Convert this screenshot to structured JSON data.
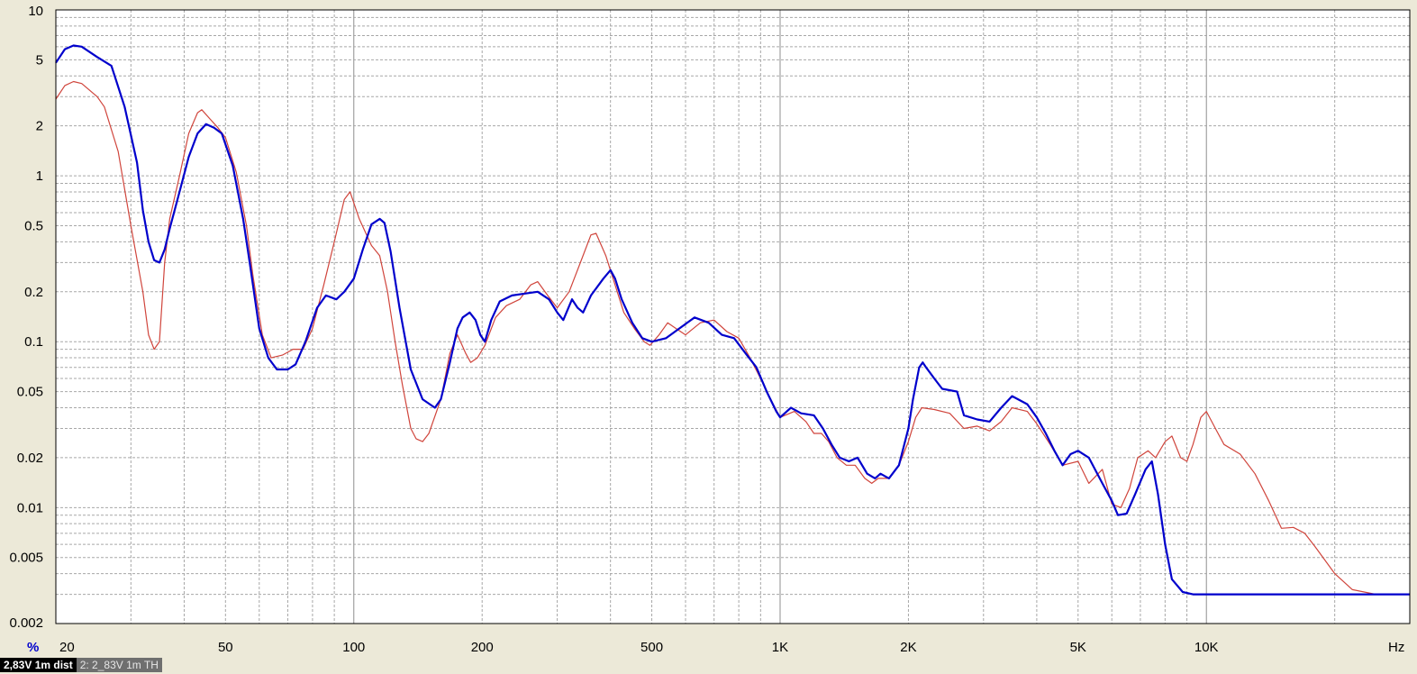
{
  "chart_data": {
    "type": "line",
    "xscale": "log",
    "yscale": "log",
    "xlim": [
      20,
      30000
    ],
    "ylim": [
      0.002,
      10
    ],
    "xlabel": "Hz",
    "ylabel": "%",
    "grid": true,
    "x_ticks": [
      {
        "value": 20,
        "label": "20"
      },
      {
        "value": 50,
        "label": "50"
      },
      {
        "value": 100,
        "label": "100"
      },
      {
        "value": 200,
        "label": "200"
      },
      {
        "value": 500,
        "label": "500"
      },
      {
        "value": 1000,
        "label": "1K"
      },
      {
        "value": 2000,
        "label": "2K"
      },
      {
        "value": 5000,
        "label": "5K"
      },
      {
        "value": 10000,
        "label": "10K"
      }
    ],
    "y_ticks": [
      {
        "value": 10,
        "label": "10"
      },
      {
        "value": 5,
        "label": "5"
      },
      {
        "value": 2,
        "label": "2"
      },
      {
        "value": 1,
        "label": "1"
      },
      {
        "value": 0.5,
        "label": "0.5"
      },
      {
        "value": 0.2,
        "label": "0.2"
      },
      {
        "value": 0.1,
        "label": "0.1"
      },
      {
        "value": 0.05,
        "label": "0.05"
      },
      {
        "value": 0.02,
        "label": "0.02"
      },
      {
        "value": 0.01,
        "label": "0.01"
      },
      {
        "value": 0.005,
        "label": "0.005"
      },
      {
        "value": 0.002,
        "label": "0.002"
      }
    ],
    "series": [
      {
        "name": "2,83V 1m dist",
        "color": "#0000cc",
        "points": [
          [
            20,
            4.8
          ],
          [
            21,
            5.8
          ],
          [
            22,
            6.1
          ],
          [
            23,
            6.0
          ],
          [
            25,
            5.2
          ],
          [
            27,
            4.6
          ],
          [
            29,
            2.6
          ],
          [
            31,
            1.2
          ],
          [
            32,
            0.62
          ],
          [
            33,
            0.4
          ],
          [
            34,
            0.31
          ],
          [
            35,
            0.3
          ],
          [
            36,
            0.36
          ],
          [
            37,
            0.48
          ],
          [
            39,
            0.8
          ],
          [
            41,
            1.3
          ],
          [
            43,
            1.8
          ],
          [
            45,
            2.05
          ],
          [
            47,
            1.95
          ],
          [
            49,
            1.8
          ],
          [
            52,
            1.15
          ],
          [
            55,
            0.55
          ],
          [
            57,
            0.3
          ],
          [
            60,
            0.12
          ],
          [
            63,
            0.08
          ],
          [
            66,
            0.068
          ],
          [
            70,
            0.068
          ],
          [
            73,
            0.073
          ],
          [
            77,
            0.1
          ],
          [
            82,
            0.16
          ],
          [
            86,
            0.19
          ],
          [
            91,
            0.18
          ],
          [
            95,
            0.2
          ],
          [
            100,
            0.24
          ],
          [
            105,
            0.36
          ],
          [
            110,
            0.51
          ],
          [
            115,
            0.55
          ],
          [
            118,
            0.52
          ],
          [
            122,
            0.35
          ],
          [
            128,
            0.16
          ],
          [
            136,
            0.068
          ],
          [
            145,
            0.045
          ],
          [
            155,
            0.04
          ],
          [
            160,
            0.045
          ],
          [
            168,
            0.075
          ],
          [
            175,
            0.12
          ],
          [
            180,
            0.14
          ],
          [
            187,
            0.15
          ],
          [
            193,
            0.135
          ],
          [
            198,
            0.11
          ],
          [
            203,
            0.1
          ],
          [
            210,
            0.135
          ],
          [
            220,
            0.175
          ],
          [
            235,
            0.19
          ],
          [
            252,
            0.195
          ],
          [
            270,
            0.2
          ],
          [
            287,
            0.18
          ],
          [
            300,
            0.15
          ],
          [
            310,
            0.135
          ],
          [
            325,
            0.18
          ],
          [
            335,
            0.16
          ],
          [
            345,
            0.15
          ],
          [
            360,
            0.19
          ],
          [
            385,
            0.24
          ],
          [
            400,
            0.27
          ],
          [
            410,
            0.24
          ],
          [
            425,
            0.18
          ],
          [
            450,
            0.13
          ],
          [
            475,
            0.105
          ],
          [
            500,
            0.1
          ],
          [
            540,
            0.105
          ],
          [
            580,
            0.12
          ],
          [
            630,
            0.14
          ],
          [
            680,
            0.13
          ],
          [
            730,
            0.11
          ],
          [
            780,
            0.105
          ],
          [
            830,
            0.085
          ],
          [
            880,
            0.07
          ],
          [
            930,
            0.05
          ],
          [
            980,
            0.038
          ],
          [
            1000,
            0.035
          ],
          [
            1060,
            0.04
          ],
          [
            1120,
            0.037
          ],
          [
            1200,
            0.036
          ],
          [
            1260,
            0.03
          ],
          [
            1320,
            0.024
          ],
          [
            1380,
            0.02
          ],
          [
            1450,
            0.019
          ],
          [
            1520,
            0.02
          ],
          [
            1600,
            0.016
          ],
          [
            1670,
            0.015
          ],
          [
            1720,
            0.016
          ],
          [
            1800,
            0.015
          ],
          [
            1900,
            0.018
          ],
          [
            2000,
            0.03
          ],
          [
            2050,
            0.045
          ],
          [
            2120,
            0.07
          ],
          [
            2160,
            0.075
          ],
          [
            2200,
            0.07
          ],
          [
            2300,
            0.06
          ],
          [
            2400,
            0.052
          ],
          [
            2600,
            0.05
          ],
          [
            2700,
            0.036
          ],
          [
            2900,
            0.034
          ],
          [
            3100,
            0.033
          ],
          [
            3300,
            0.04
          ],
          [
            3500,
            0.047
          ],
          [
            3800,
            0.042
          ],
          [
            4000,
            0.035
          ],
          [
            4200,
            0.028
          ],
          [
            4400,
            0.022
          ],
          [
            4600,
            0.018
          ],
          [
            4800,
            0.021
          ],
          [
            5000,
            0.022
          ],
          [
            5300,
            0.02
          ],
          [
            5700,
            0.014
          ],
          [
            6000,
            0.011
          ],
          [
            6200,
            0.009
          ],
          [
            6500,
            0.0092
          ],
          [
            6800,
            0.012
          ],
          [
            7200,
            0.017
          ],
          [
            7450,
            0.019
          ],
          [
            7700,
            0.012
          ],
          [
            8000,
            0.006
          ],
          [
            8300,
            0.0037
          ],
          [
            8800,
            0.0031
          ],
          [
            9300,
            0.003
          ],
          [
            10000,
            0.003
          ],
          [
            15000,
            0.003
          ],
          [
            20000,
            0.003
          ],
          [
            26000,
            0.003
          ],
          [
            30000,
            0.003
          ]
        ]
      },
      {
        "name": "2: 2_83V 1m TH",
        "color": "#d0453c",
        "points": [
          [
            20,
            2.9
          ],
          [
            21,
            3.5
          ],
          [
            22,
            3.7
          ],
          [
            23,
            3.6
          ],
          [
            25,
            3.0
          ],
          [
            26,
            2.6
          ],
          [
            28,
            1.4
          ],
          [
            30,
            0.5
          ],
          [
            32,
            0.2
          ],
          [
            33,
            0.11
          ],
          [
            34,
            0.09
          ],
          [
            35,
            0.1
          ],
          [
            36,
            0.3
          ],
          [
            37,
            0.55
          ],
          [
            39,
            1.0
          ],
          [
            41,
            1.8
          ],
          [
            43,
            2.4
          ],
          [
            44,
            2.5
          ],
          [
            46,
            2.2
          ],
          [
            48,
            1.95
          ],
          [
            50,
            1.7
          ],
          [
            53,
            1.05
          ],
          [
            56,
            0.5
          ],
          [
            58,
            0.25
          ],
          [
            61,
            0.11
          ],
          [
            64,
            0.08
          ],
          [
            68,
            0.083
          ],
          [
            72,
            0.09
          ],
          [
            76,
            0.09
          ],
          [
            80,
            0.12
          ],
          [
            85,
            0.22
          ],
          [
            90,
            0.4
          ],
          [
            95,
            0.72
          ],
          [
            98,
            0.8
          ],
          [
            103,
            0.55
          ],
          [
            110,
            0.38
          ],
          [
            115,
            0.33
          ],
          [
            120,
            0.2
          ],
          [
            125,
            0.1
          ],
          [
            130,
            0.055
          ],
          [
            136,
            0.03
          ],
          [
            140,
            0.026
          ],
          [
            145,
            0.025
          ],
          [
            150,
            0.028
          ],
          [
            160,
            0.045
          ],
          [
            168,
            0.085
          ],
          [
            175,
            0.11
          ],
          [
            183,
            0.085
          ],
          [
            188,
            0.075
          ],
          [
            195,
            0.08
          ],
          [
            203,
            0.095
          ],
          [
            215,
            0.14
          ],
          [
            228,
            0.165
          ],
          [
            245,
            0.18
          ],
          [
            260,
            0.22
          ],
          [
            270,
            0.23
          ],
          [
            285,
            0.19
          ],
          [
            300,
            0.16
          ],
          [
            320,
            0.2
          ],
          [
            340,
            0.3
          ],
          [
            360,
            0.44
          ],
          [
            370,
            0.45
          ],
          [
            390,
            0.33
          ],
          [
            410,
            0.22
          ],
          [
            430,
            0.15
          ],
          [
            455,
            0.12
          ],
          [
            480,
            0.1
          ],
          [
            495,
            0.095
          ],
          [
            520,
            0.11
          ],
          [
            545,
            0.13
          ],
          [
            570,
            0.12
          ],
          [
            600,
            0.11
          ],
          [
            650,
            0.13
          ],
          [
            700,
            0.135
          ],
          [
            750,
            0.115
          ],
          [
            800,
            0.105
          ],
          [
            850,
            0.08
          ],
          [
            900,
            0.06
          ],
          [
            950,
            0.045
          ],
          [
            1000,
            0.035
          ],
          [
            1080,
            0.038
          ],
          [
            1150,
            0.033
          ],
          [
            1200,
            0.028
          ],
          [
            1250,
            0.028
          ],
          [
            1300,
            0.025
          ],
          [
            1360,
            0.02
          ],
          [
            1430,
            0.018
          ],
          [
            1500,
            0.018
          ],
          [
            1580,
            0.015
          ],
          [
            1640,
            0.014
          ],
          [
            1700,
            0.015
          ],
          [
            1800,
            0.015
          ],
          [
            1900,
            0.018
          ],
          [
            2000,
            0.025
          ],
          [
            2080,
            0.035
          ],
          [
            2150,
            0.04
          ],
          [
            2300,
            0.039
          ],
          [
            2500,
            0.037
          ],
          [
            2700,
            0.03
          ],
          [
            2900,
            0.031
          ],
          [
            3100,
            0.029
          ],
          [
            3300,
            0.033
          ],
          [
            3500,
            0.04
          ],
          [
            3800,
            0.038
          ],
          [
            4000,
            0.032
          ],
          [
            4300,
            0.024
          ],
          [
            4600,
            0.018
          ],
          [
            5000,
            0.019
          ],
          [
            5300,
            0.014
          ],
          [
            5700,
            0.017
          ],
          [
            6000,
            0.0105
          ],
          [
            6300,
            0.01
          ],
          [
            6600,
            0.013
          ],
          [
            6900,
            0.02
          ],
          [
            7300,
            0.022
          ],
          [
            7600,
            0.02
          ],
          [
            8000,
            0.025
          ],
          [
            8300,
            0.027
          ],
          [
            8700,
            0.02
          ],
          [
            9000,
            0.019
          ],
          [
            9300,
            0.024
          ],
          [
            9700,
            0.035
          ],
          [
            10000,
            0.038
          ],
          [
            10500,
            0.03
          ],
          [
            11000,
            0.024
          ],
          [
            12000,
            0.021
          ],
          [
            13000,
            0.016
          ],
          [
            14000,
            0.011
          ],
          [
            15000,
            0.0075
          ],
          [
            16000,
            0.0076
          ],
          [
            17000,
            0.007
          ],
          [
            18000,
            0.0058
          ],
          [
            20000,
            0.004
          ],
          [
            22000,
            0.0032
          ],
          [
            25000,
            0.003
          ],
          [
            30000,
            0.003
          ]
        ]
      }
    ]
  },
  "legend": {
    "active_label": "2,83V 1m dist",
    "inactive_label": "2: 2_83V 1m TH"
  },
  "colors": {
    "frame": "#000000",
    "background": "#ffffff",
    "grid": "#a7a7a7",
    "decade_grid": "#8f8f8f"
  }
}
